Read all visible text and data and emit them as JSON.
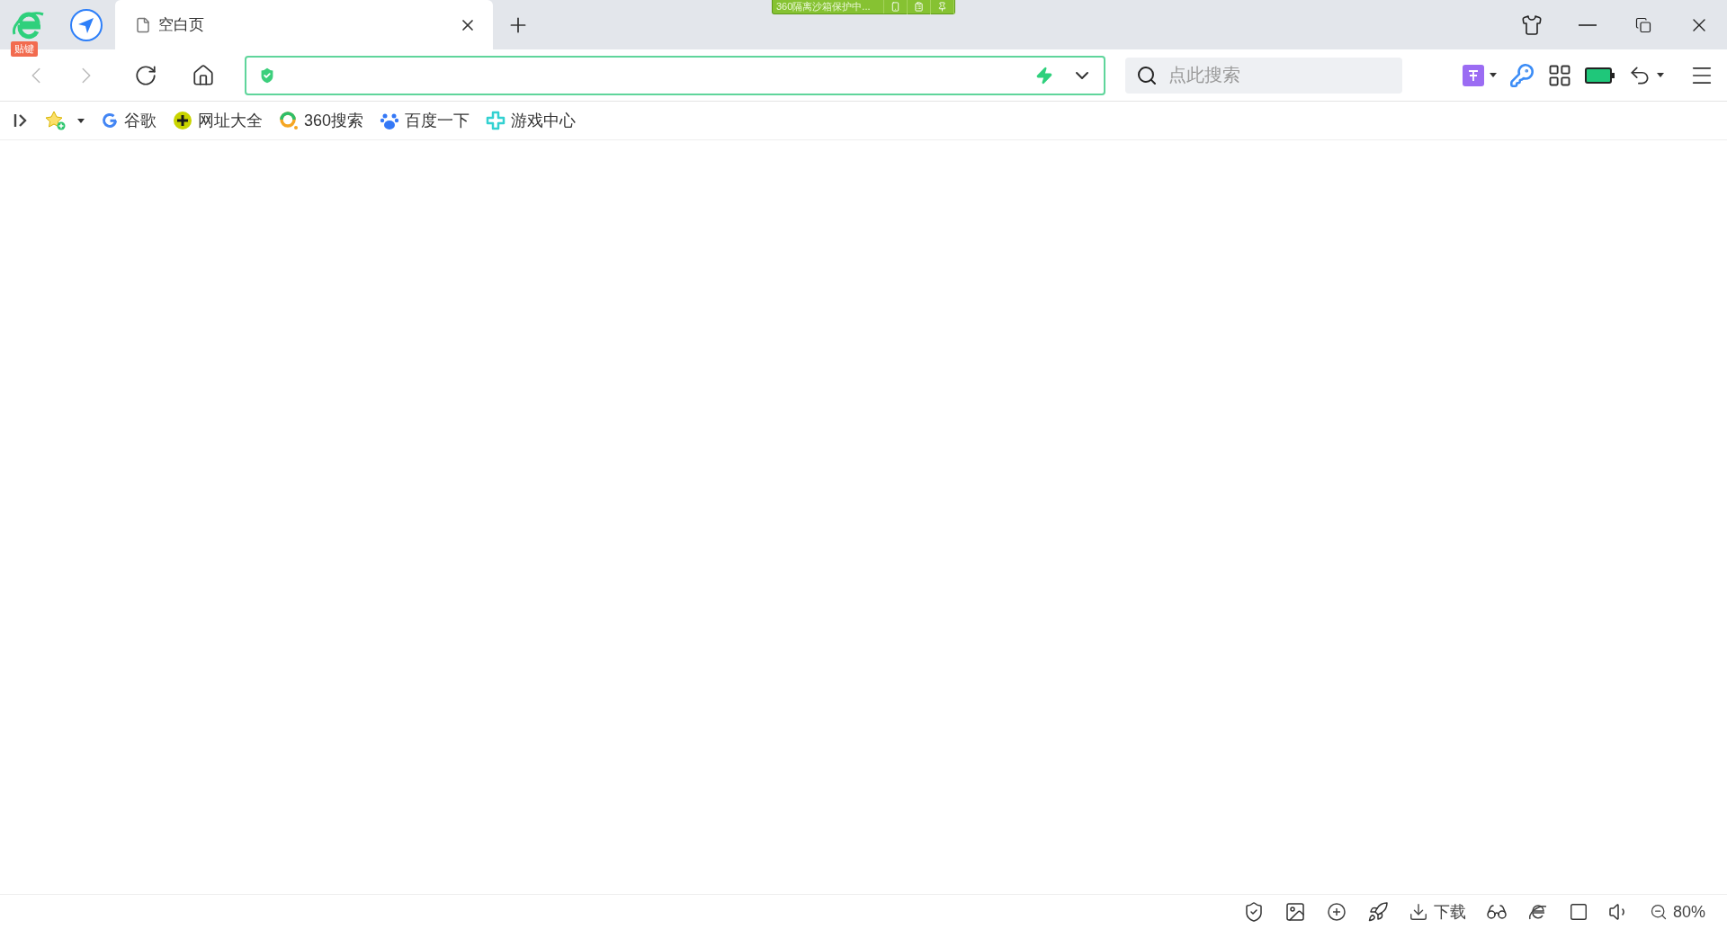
{
  "tab_bar": {
    "logo_badge": "贴键",
    "sandbox_banner": "360隔离沙箱保护中...",
    "tabs": [
      {
        "title": "空白页",
        "selected": true
      }
    ]
  },
  "toolbar": {
    "back": {
      "disabled": true
    },
    "forward": {
      "disabled": true
    },
    "search": {
      "placeholder": "点此搜索"
    }
  },
  "bookmarks": [
    {
      "label": "谷歌",
      "kind": "google"
    },
    {
      "label": "网址大全",
      "kind": "directory"
    },
    {
      "label": "360搜索",
      "kind": "search360"
    },
    {
      "label": "百度一下",
      "kind": "baidu"
    },
    {
      "label": "游戏中心",
      "kind": "games"
    }
  ],
  "status_bar": {
    "download": "下载",
    "zoom": "80%"
  }
}
